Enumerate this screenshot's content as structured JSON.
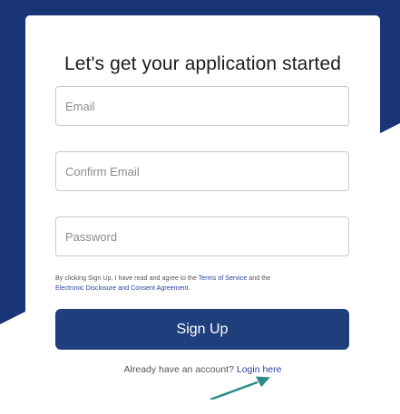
{
  "colors": {
    "background_band": "#1a3577",
    "primary_button": "#1f3f7c",
    "link": "#2a3f9e",
    "annotation_arrow": "#2b8a8a"
  },
  "card": {
    "title": "Let's get your application started"
  },
  "form": {
    "email_placeholder": "Email",
    "confirm_email_placeholder": "Confirm Email",
    "password_placeholder": "Password",
    "email_value": "",
    "confirm_email_value": "",
    "password_value": ""
  },
  "terms": {
    "prefix": "By clicking Sign Up, I have read and agree to the ",
    "terms_link": "Terms of Service",
    "middle": " and the ",
    "disclosure_link": "Electronic Disclosure and Consent Agreement",
    "suffix": "."
  },
  "signup_button": {
    "label": "Sign Up"
  },
  "login": {
    "prompt": "Already have an account? ",
    "link": "Login here"
  },
  "annotation": {
    "icon": "arrow-pointer-icon"
  }
}
